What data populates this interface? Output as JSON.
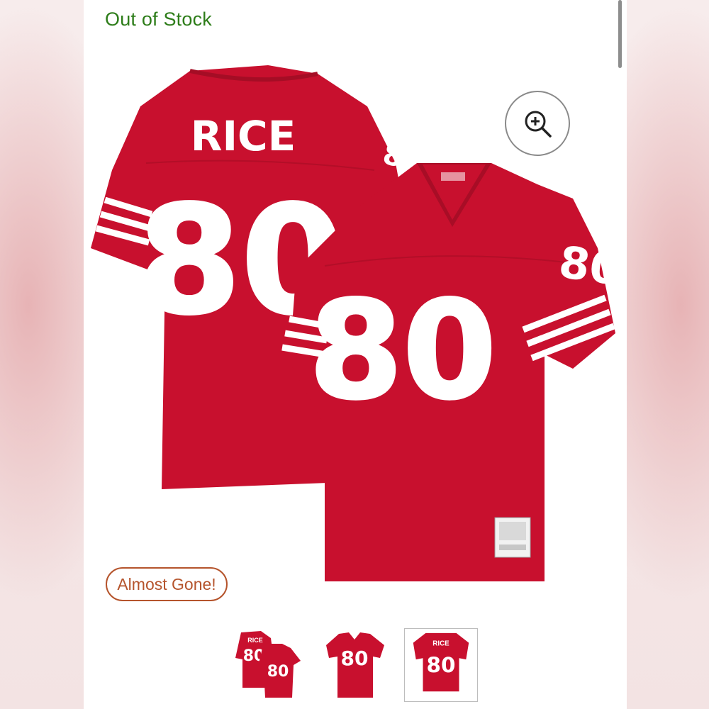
{
  "status": {
    "stock_label": "Out of Stock"
  },
  "badge": {
    "label": "Almost Gone!"
  },
  "product": {
    "back": {
      "name": "RICE",
      "number": "80"
    },
    "front": {
      "number": "80"
    },
    "sleeve_number": "80"
  },
  "thumbnails": [
    {
      "name": "RICE",
      "back_number": "80",
      "front_number": "80"
    },
    {
      "front_number": "80"
    },
    {
      "name": "RICE",
      "back_number": "80",
      "selected": true
    }
  ],
  "colors": {
    "jersey_red": "#c8102e",
    "stock_green": "#2e7d1a",
    "badge_orange": "#b5542c"
  },
  "icons": {
    "zoom": "zoom-in-icon"
  }
}
